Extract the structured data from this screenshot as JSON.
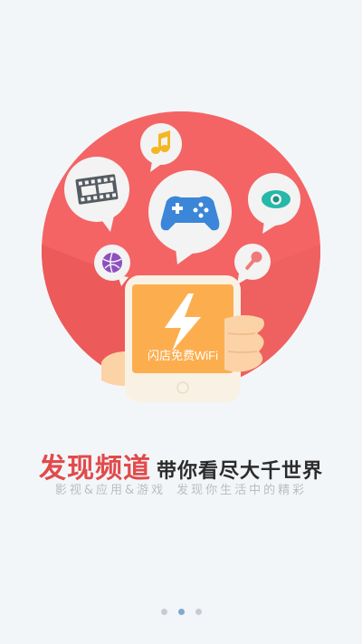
{
  "app": {
    "brand_text": "闪店免费WiFi"
  },
  "headline": {
    "accent": "发现频道",
    "rest": "带你看尽大千世界"
  },
  "subline": {
    "left": "影视&应用&游戏",
    "right": "发现你生活中的精彩"
  },
  "icons": [
    "film-strip-icon",
    "music-note-icon",
    "gamepad-icon",
    "eye-icon",
    "sports-ball-icon",
    "microphone-icon",
    "lightning-icon"
  ],
  "pager": {
    "count": 3,
    "active_index": 1
  },
  "colors": {
    "circle": "#f46464",
    "phone_body": "#f9f2e4",
    "phone_screen": "#fcae4f",
    "accent_text": "#e24a4a",
    "dot_active": "#7fa9cf",
    "dot_inactive": "#c7ccd2"
  }
}
